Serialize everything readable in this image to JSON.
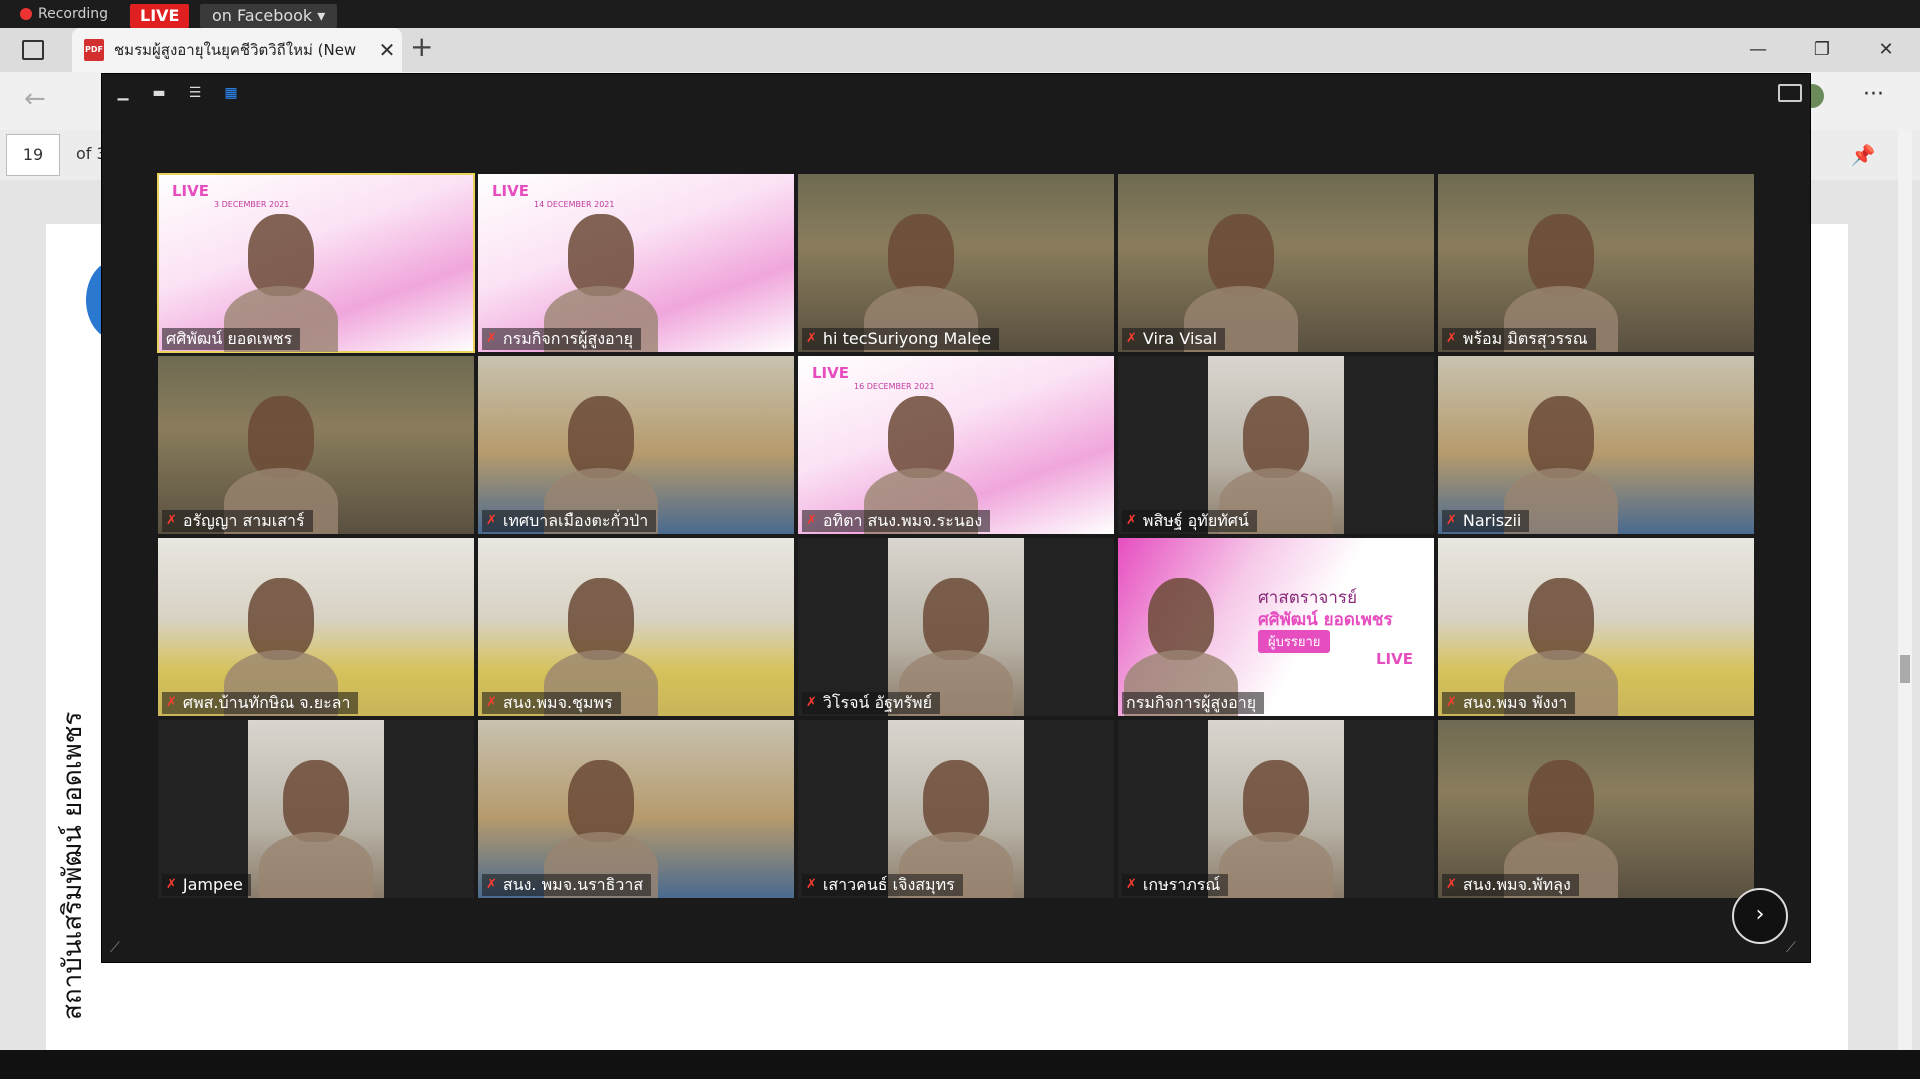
{
  "overlay": {
    "recording": "Recording",
    "live": "LIVE",
    "facebook": "on Facebook"
  },
  "browser": {
    "tab_title": "ชมรมผู้สูงอายุในยุคชีวิตวิถีใหม่ (New",
    "tab_icon": "pdf-icon"
  },
  "pdf": {
    "page_number": "19",
    "page_of": "of 3",
    "side_text": "สถาบันเสริมพัฒน์ ยอดเพชร"
  },
  "meeting": {
    "tiles": [
      {
        "name": "ศศิพัฒน์ ยอดเพชร",
        "muted": false,
        "selected": true,
        "bg": "pink"
      },
      {
        "name": "กรมกิจการผู้สูงอายุ",
        "muted": true,
        "bg": "pink"
      },
      {
        "name": "hi tecSuriyong  Malee",
        "muted": true,
        "bg": "home"
      },
      {
        "name": "Vira Visal",
        "muted": true,
        "bg": "home"
      },
      {
        "name": "พร้อม มิตรสุวรรณ",
        "muted": true,
        "bg": "home"
      },
      {
        "name": "อรัญญา สามเสาร์",
        "muted": true,
        "bg": "home"
      },
      {
        "name": "เทศบาลเมืองตะกั่วป่า",
        "muted": true,
        "bg": "office"
      },
      {
        "name": "อทิตา สนง.พมจ.ระนอง",
        "muted": true,
        "bg": "pink"
      },
      {
        "name": "พสิษฐ์ อุทัยทัศน์",
        "muted": true,
        "bg": "narrow"
      },
      {
        "name": "Nariszii",
        "muted": true,
        "bg": "office"
      },
      {
        "name": "ศพส.บ้านทักษิณ จ.ยะลา",
        "muted": true,
        "bg": "meeting"
      },
      {
        "name": "สนง.พมจ.ชุมพร",
        "muted": true,
        "bg": "meeting"
      },
      {
        "name": "วิโรจน์ อัฐทรัพย์",
        "muted": true,
        "bg": "narrow"
      },
      {
        "name": "กรมกิจการผู้สูงอายุ",
        "muted": false,
        "bg": "banner"
      },
      {
        "name": "สนง.พมจ พังงา",
        "muted": true,
        "bg": "meeting"
      },
      {
        "name": "Jampee",
        "muted": true,
        "bg": "narrow"
      },
      {
        "name": "สนง. พมจ.นราธิวาส",
        "muted": true,
        "bg": "office"
      },
      {
        "name": "เสาวคนธ์ เจิงสมุทร",
        "muted": true,
        "bg": "narrow"
      },
      {
        "name": "เกษราภรณ์",
        "muted": true,
        "bg": "narrow"
      },
      {
        "name": "สนง.พมจ.พัทลุง",
        "muted": true,
        "bg": "home"
      }
    ],
    "banner_title": "ศาสตราจารย์",
    "banner_name": "ศศิพัฒน์ ยอดเพชร",
    "banner_role": "ผู้บรรยาย",
    "banner_live": "LIVE",
    "seminar_dates": [
      "3 DECEMBER 2021",
      "14 DECEMBER 2021",
      "16 DECEMBER 2021"
    ]
  },
  "colors": {
    "live_red": "#e02020",
    "muted_red": "#ff3b30",
    "accent_blue": "#2d8cff",
    "selected_outline": "#e7d35a",
    "banner_pink": "#e64ec0"
  }
}
